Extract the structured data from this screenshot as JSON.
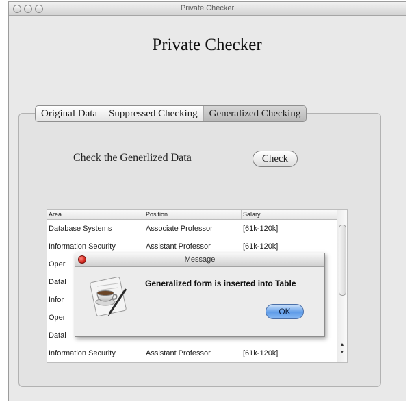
{
  "window": {
    "title": "Private Checker"
  },
  "app": {
    "title": "Private Checker"
  },
  "tabs": [
    {
      "label": "Original Data"
    },
    {
      "label": "Suppressed Checking"
    },
    {
      "label": "Generalized Checking",
      "active": true
    }
  ],
  "check": {
    "label": "Check the Generlized Data",
    "button_label": "Check"
  },
  "table": {
    "headers": [
      "Area",
      "Position",
      "Salary"
    ],
    "rows": [
      [
        "Database Systems",
        "Associate Professor",
        "[61k-120k]"
      ],
      [
        "Information Security",
        "Assistant Professor",
        "[61k-120k]"
      ],
      [
        "Oper",
        "",
        ""
      ],
      [
        "Datal",
        "",
        ""
      ],
      [
        "Infor",
        "",
        ""
      ],
      [
        "Oper",
        "",
        ""
      ],
      [
        "Datal",
        "",
        ""
      ],
      [
        "Information Security",
        "Assistant Professor",
        "[61k-120k]"
      ]
    ]
  },
  "dialog": {
    "title": "Message",
    "message": "Generalized form is inserted into Table",
    "ok_label": "OK",
    "icon": "message-app-icon"
  },
  "colors": {
    "ok_button": "#5f9ce8",
    "close_dot": "#d3261d"
  }
}
